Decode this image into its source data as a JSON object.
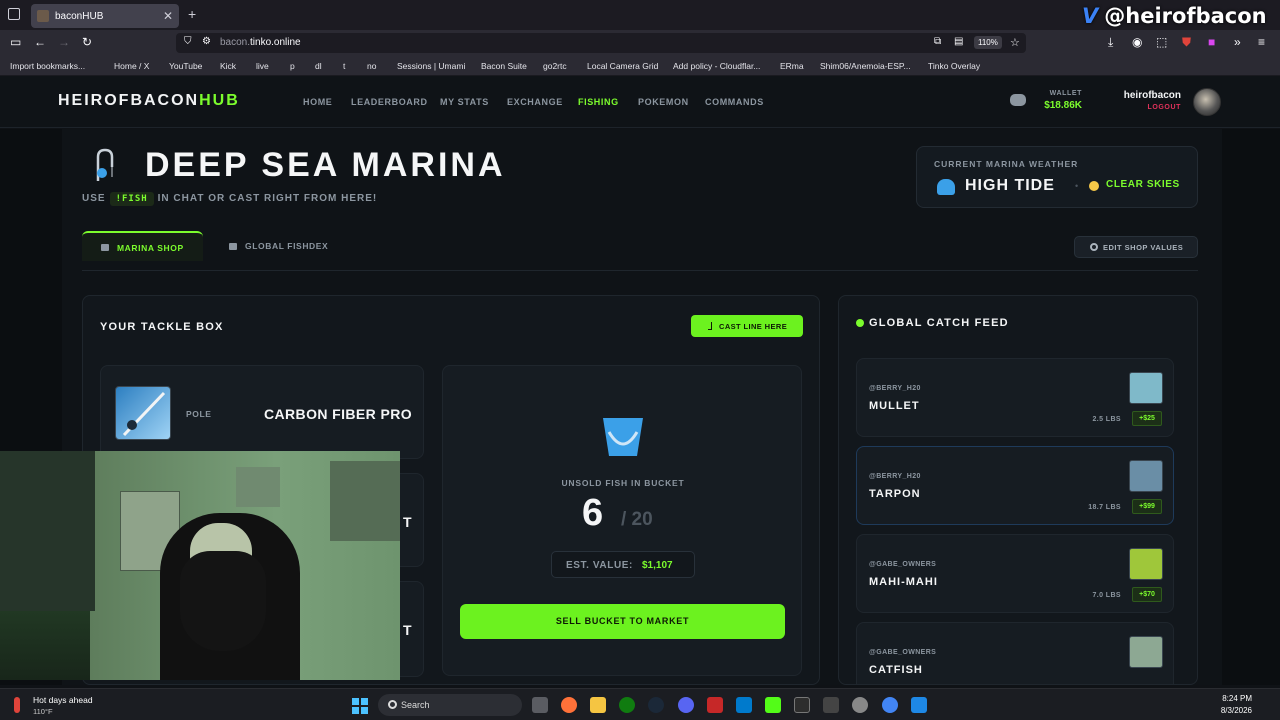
{
  "browser": {
    "tab_title": "baconHUB",
    "url_domain": "bacon.",
    "url_host": "tinko.online",
    "zoom": "110%",
    "bookmarks": [
      "Import bookmarks...",
      "Home / X",
      "YouTube",
      "Kick",
      "live",
      "p",
      "dl",
      "t",
      "no",
      "Sessions | Umami",
      "Bacon Suite",
      "go2rtc",
      "Local Camera Grid",
      "Add policy - Cloudflar...",
      "ERma",
      "Shim06/Anemoia-ESP...",
      "Tinko Overlay"
    ]
  },
  "overlay": {
    "handle": "@heirofbacon",
    "logo_letter": "V"
  },
  "header": {
    "logo_main": "HEIROFBACON",
    "logo_accent": "HUB",
    "nav": [
      "HOME",
      "LEADERBOARD",
      "MY STATS",
      "EXCHANGE",
      "FISHING",
      "POKEMON",
      "COMMANDS"
    ],
    "wallet_label": "WALLET",
    "wallet_value": "$18.86K",
    "username": "heirofbacon",
    "logout": "LOGOUT"
  },
  "page": {
    "title": "DEEP SEA MARINA",
    "subtitle_pre": "USE",
    "subtitle_cmd": "!FISH",
    "subtitle_post": "IN CHAT OR CAST RIGHT FROM HERE!",
    "weather_label": "CURRENT MARINA WEATHER",
    "weather_tide": "HIGH TIDE",
    "weather_sep": "•",
    "weather_sky": "CLEAR SKIES",
    "tab_shop": "MARINA SHOP",
    "tab_dex": "GLOBAL FISHDEX",
    "edit_button": "EDIT SHOP VALUES"
  },
  "tackle": {
    "title": "YOUR TACKLE BOX",
    "cast_button": "CAST LINE HERE",
    "slots": [
      {
        "type": "POLE",
        "name": "CARBON FIBER PRO"
      },
      {
        "type": "",
        "name": "T"
      },
      {
        "type": "",
        "name": "T"
      }
    ],
    "bucket_label": "UNSOLD FISH IN BUCKET",
    "bucket_count": "6",
    "bucket_max": "/ 20",
    "est_label": "EST. VALUE:",
    "est_value": "$1,107",
    "sell_button": "SELL BUCKET TO MARKET"
  },
  "feed": {
    "title": "GLOBAL CATCH FEED",
    "items": [
      {
        "user": "@BERRY_H20",
        "fish": "MULLET",
        "weight": "2.5 LBS",
        "value": "+$25",
        "img": "#7fb9c9"
      },
      {
        "user": "@BERRY_H20",
        "fish": "TARPON",
        "weight": "18.7 LBS",
        "value": "+$99",
        "img": "#6a8ea6"
      },
      {
        "user": "@GABE_OWNERS",
        "fish": "MAHI-MAHI",
        "weight": "7.0 LBS",
        "value": "+$70",
        "img": "#9fc73a"
      },
      {
        "user": "@GABE_OWNERS",
        "fish": "CATFISH",
        "weight": "",
        "value": "",
        "img": "#8da893"
      }
    ]
  },
  "taskbar": {
    "weather_title": "Hot days ahead",
    "weather_temp": "110°F",
    "search": "Search",
    "time": "8:24 PM",
    "date": "8/3/2026"
  },
  "colors": {
    "accent": "#7cfc2d",
    "logout": "#e0315a",
    "bg": "#0f1317"
  }
}
